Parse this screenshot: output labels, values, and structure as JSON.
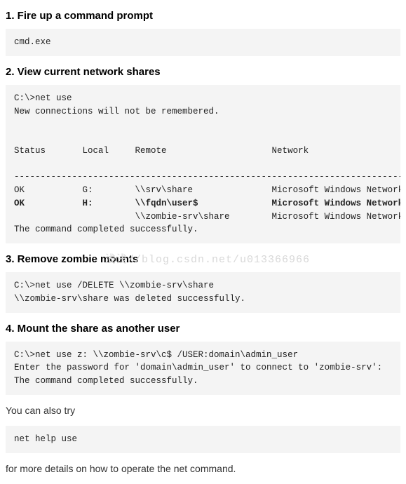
{
  "watermark": {
    "prefix": "浅浅",
    "url": "//blog.csdn.net/u013366966"
  },
  "steps": [
    {
      "num": "1.",
      "title": "Fire up a command prompt",
      "code": "cmd.exe"
    },
    {
      "num": "2.",
      "title": "View current network shares",
      "code": "C:\\>net use\nNew connections will not be remembered.\n\n\nStatus       Local     Remote                    Network\n\n----------------------------------------------------------------------------\nOK           G:        \\\\srv\\share               Microsoft Windows Network\nOK           H:        \\\\fqdn\\user$              Microsoft Windows Network\n                       \\\\zombie-srv\\share        Microsoft Windows Network\nThe command completed successfully.",
      "bold_line_index": 8
    },
    {
      "num": "3.",
      "title": "Remove zombie mounts",
      "code": "C:\\>net use /DELETE \\\\zombie-srv\\share\n\\\\zombie-srv\\share was deleted successfully."
    },
    {
      "num": "4.",
      "title": "Mount the share as another user",
      "code": "C:\\>net use z: \\\\zombie-srv\\c$ /USER:domain\\admin_user\nEnter the password for 'domain\\admin_user' to connect to 'zombie-srv':\nThe command completed successfully."
    }
  ],
  "footer": {
    "line1": "You can also try",
    "code": "net help use",
    "line2": "for more details on how to operate the net command."
  }
}
